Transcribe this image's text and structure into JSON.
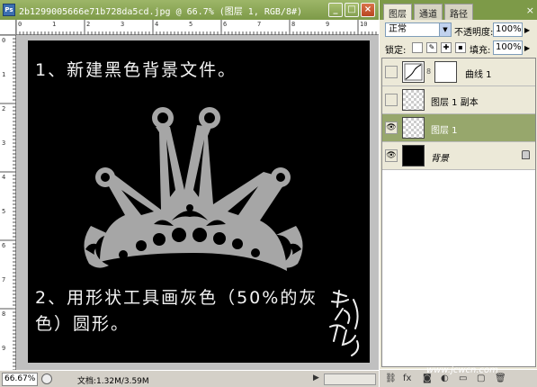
{
  "document": {
    "title": "2b1299005666e71b728da5cd.jpg @ 66.7% (图层 1, RGB/8#)",
    "ps_icon": "Ps",
    "window_buttons": [
      "_",
      "□",
      "×"
    ],
    "ruler_h": [
      "0",
      "1",
      "2",
      "3",
      "4",
      "5",
      "6",
      "7",
      "8",
      "9",
      "10"
    ],
    "ruler_v": [
      "0",
      "1",
      "2",
      "3",
      "4",
      "5",
      "6",
      "7",
      "8",
      "9"
    ],
    "canvas": {
      "step1": "1、新建黑色背景文件。",
      "step2": "2、用形状工具画灰色（50%的灰",
      "step2b": "色）圆形。",
      "crown_color": "#a6a6a6"
    },
    "status": {
      "zoom": "66.67%",
      "doc_info": "文档:1.32M/3.59M",
      "nav_arrow": "▶"
    }
  },
  "layers_panel": {
    "tabs": [
      "图层",
      "通道",
      "路径"
    ],
    "close": "×",
    "blend_mode": "正常",
    "opacity_label": "不透明度:",
    "opacity_value": "100%",
    "lock_label": "锁定:",
    "fill_label": "填充:",
    "fill_value": "100%",
    "layers": [
      {
        "name": "曲线 1",
        "type": "adjustment"
      },
      {
        "name": "图层 1 副本",
        "type": "normal"
      },
      {
        "name": "图层 1",
        "type": "normal",
        "selected": true,
        "visible": true
      },
      {
        "name": "背景",
        "type": "background",
        "visible": true,
        "locked": true
      }
    ],
    "footer_icons": [
      "link-icon",
      "fx-icon",
      "mask-icon",
      "adjustment-icon",
      "folder-icon",
      "new-layer-icon",
      "trash-icon"
    ]
  },
  "watermark": "www.jcwcn.com",
  "colors": {
    "titlebar": "#8aa656",
    "selected_layer": "#97a76c",
    "canvas": "#000000"
  }
}
